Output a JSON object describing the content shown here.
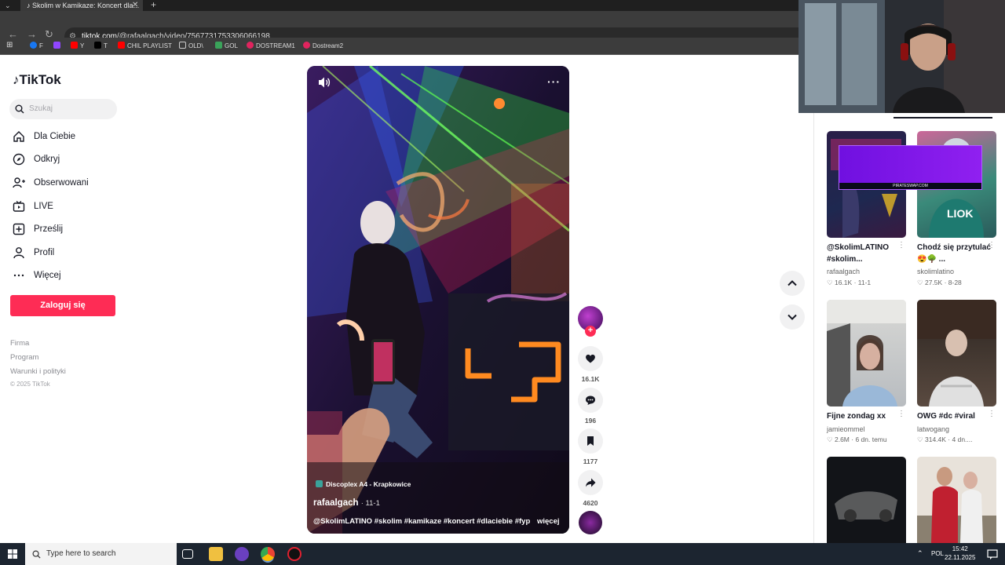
{
  "browser": {
    "tab_title": "Skolim w Kamikaze: Koncert dla...",
    "url_domain": "tiktok.com",
    "url_path": "/@rafaalgach/video/7567731753306066198",
    "bookmarks": [
      {
        "label": "F",
        "color": "#1877f2"
      },
      {
        "label": "",
        "color": "#9146ff"
      },
      {
        "label": "Y",
        "color": "#ff0000"
      },
      {
        "label": "T",
        "color": "#000000"
      },
      {
        "label": "CHIL PLAYLIST",
        "color": "#ff0000"
      },
      {
        "label": "OLD\\",
        "color": "#cccccc"
      },
      {
        "label": "GOL",
        "color": "#3aa35a"
      },
      {
        "label": "DOSTREAM1",
        "color": "#e0245e"
      },
      {
        "label": "Dostream2",
        "color": "#e0245e"
      }
    ]
  },
  "sidebar": {
    "logo": "TikTok",
    "search_placeholder": "Szukaj",
    "items": [
      {
        "label": "Dla Ciebie",
        "icon": "home-icon"
      },
      {
        "label": "Odkryj",
        "icon": "compass-icon"
      },
      {
        "label": "Obserwowani",
        "icon": "following-icon"
      },
      {
        "label": "LIVE",
        "icon": "live-icon"
      },
      {
        "label": "Prześlij",
        "icon": "upload-icon"
      },
      {
        "label": "Profil",
        "icon": "profile-icon"
      },
      {
        "label": "Więcej",
        "icon": "more-icon"
      }
    ],
    "login_label": "Zaloguj się",
    "footer_links": [
      "Firma",
      "Program",
      "Warunki i polityki"
    ],
    "copyright": "© 2025 TikTok"
  },
  "video": {
    "location": "Discoplex A4 - Krapkowice",
    "author": "rafaalgach",
    "date": "· 11-1",
    "caption": "@SkolimLATINO #skolim #kamikaze #koncert #dlaciebie #fyp",
    "more_label": "więcej",
    "likes": "16.1K",
    "comments": "196",
    "saves": "1177",
    "shares": "4620"
  },
  "related": [
    {
      "title": "@SkolimLATINO #skolim...",
      "author": "rafaalgach",
      "likes": "16.1K",
      "date": "11-1"
    },
    {
      "title": "Chodź się przytulać 😍🌳 ...",
      "author": "skolimlatino",
      "likes": "27.5K",
      "date": "8-28"
    },
    {
      "title": "Fijne zondag xx",
      "author": "jamieommel",
      "likes": "2.6M",
      "date": "6 dn. temu"
    },
    {
      "title": "OWG #dc #viral",
      "author": "latwogang",
      "likes": "314.4K",
      "date": "4 dn...."
    }
  ],
  "overlay_banner": "PIRATESWAP.COM",
  "taskbar": {
    "search_placeholder": "Type here to search",
    "lang": "POL",
    "time": "15:42",
    "date": "22.11.2025"
  }
}
